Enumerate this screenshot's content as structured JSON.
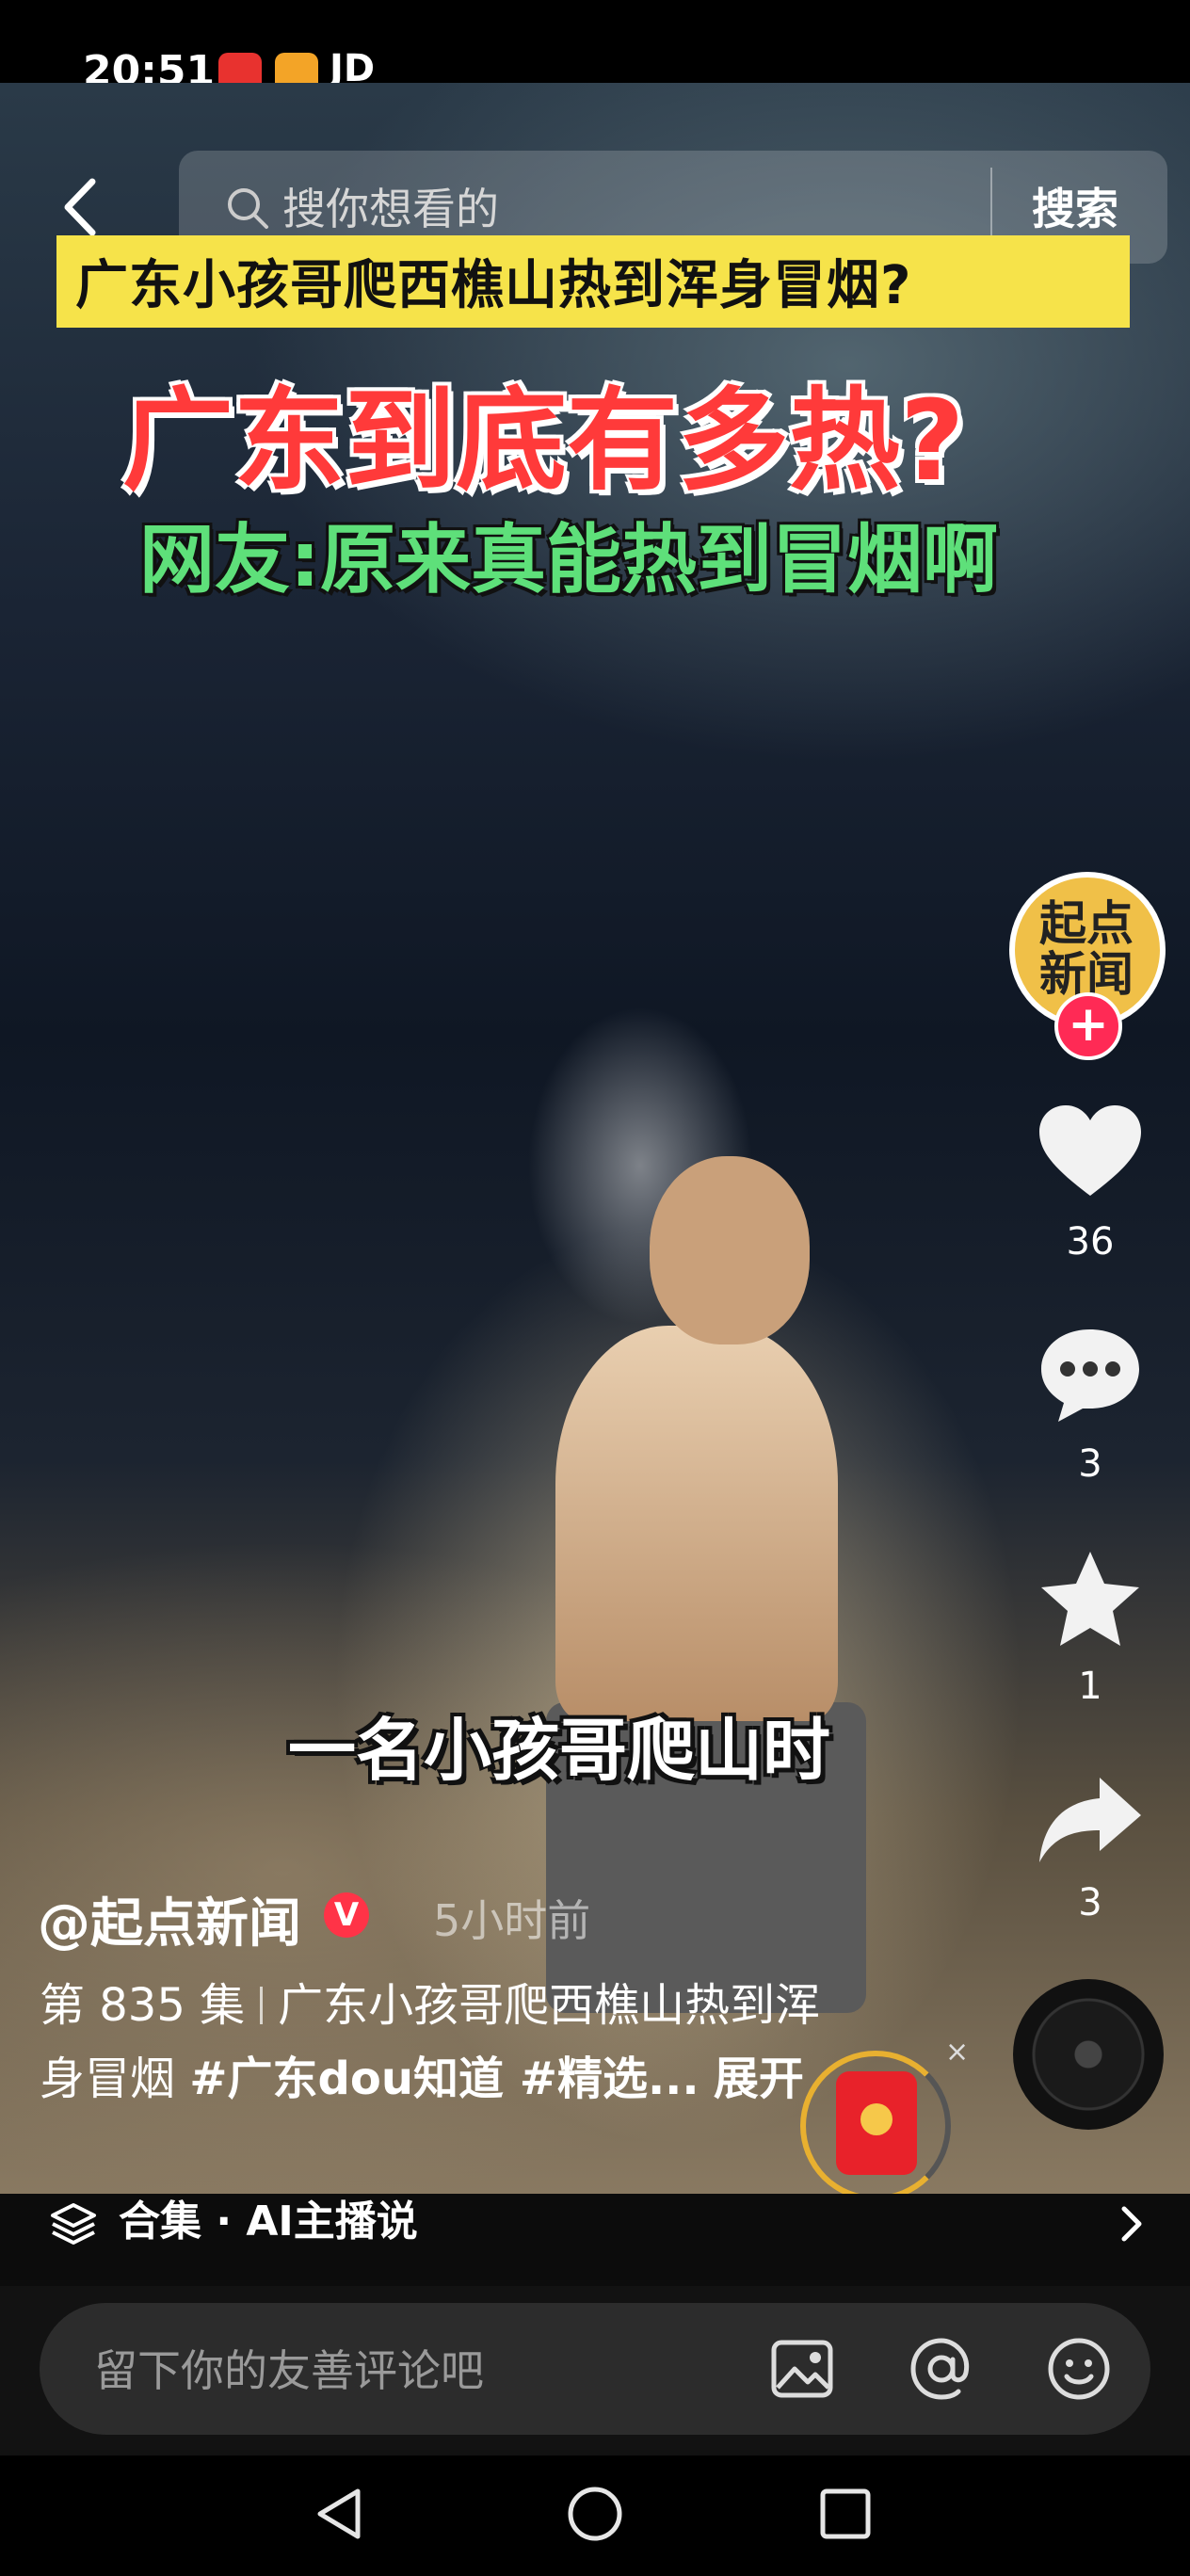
{
  "status_bar": {
    "time": "20:51",
    "app_icons": [
      "618-promo-icon",
      "app-store-icon"
    ],
    "carrier_text": "JD"
  },
  "search": {
    "placeholder": "搜你想看的",
    "button_label": "搜索"
  },
  "video": {
    "overlay_banner": "广东小孩哥爬西樵山热到浑身冒烟?",
    "headline": "广东到底有多热?",
    "subheadline": "网友:原来真能热到冒烟啊",
    "subtitle": "一名小孩哥爬山时"
  },
  "creator": {
    "avatar_text": "起点新闻",
    "handle": "@起点新闻",
    "verified_badge": "V",
    "posted": "5小时前"
  },
  "actions": {
    "likes": "36",
    "comments": "3",
    "favorites": "1",
    "shares": "3"
  },
  "caption": {
    "episode": "第 835 集",
    "line1_text": "广东小孩哥爬西樵山热到浑",
    "line2_text": "身冒烟",
    "hashtags": "#广东dou知道 #精选...",
    "expand_label": "展开"
  },
  "collection": {
    "label": "合集 · AI主播说"
  },
  "comment_input": {
    "placeholder": "留下你的友善评论吧"
  },
  "icons": {
    "back": "chevron-left-icon",
    "search": "search-icon",
    "like": "heart-icon",
    "comment": "comment-bubble-icon",
    "favorite": "star-icon",
    "share": "share-arrow-icon",
    "image": "image-icon",
    "mention": "at-icon",
    "emoji": "emoji-icon",
    "nav_back": "triangle-back-icon",
    "nav_home": "circle-home-icon",
    "nav_recents": "square-recents-icon"
  },
  "colors": {
    "banner_yellow": "#f6e34a",
    "headline_red": "#ff3a3a",
    "subheadline_green": "#5ee07a",
    "follow_pink": "#ff2a55",
    "redpacket_red": "#e8222a"
  }
}
